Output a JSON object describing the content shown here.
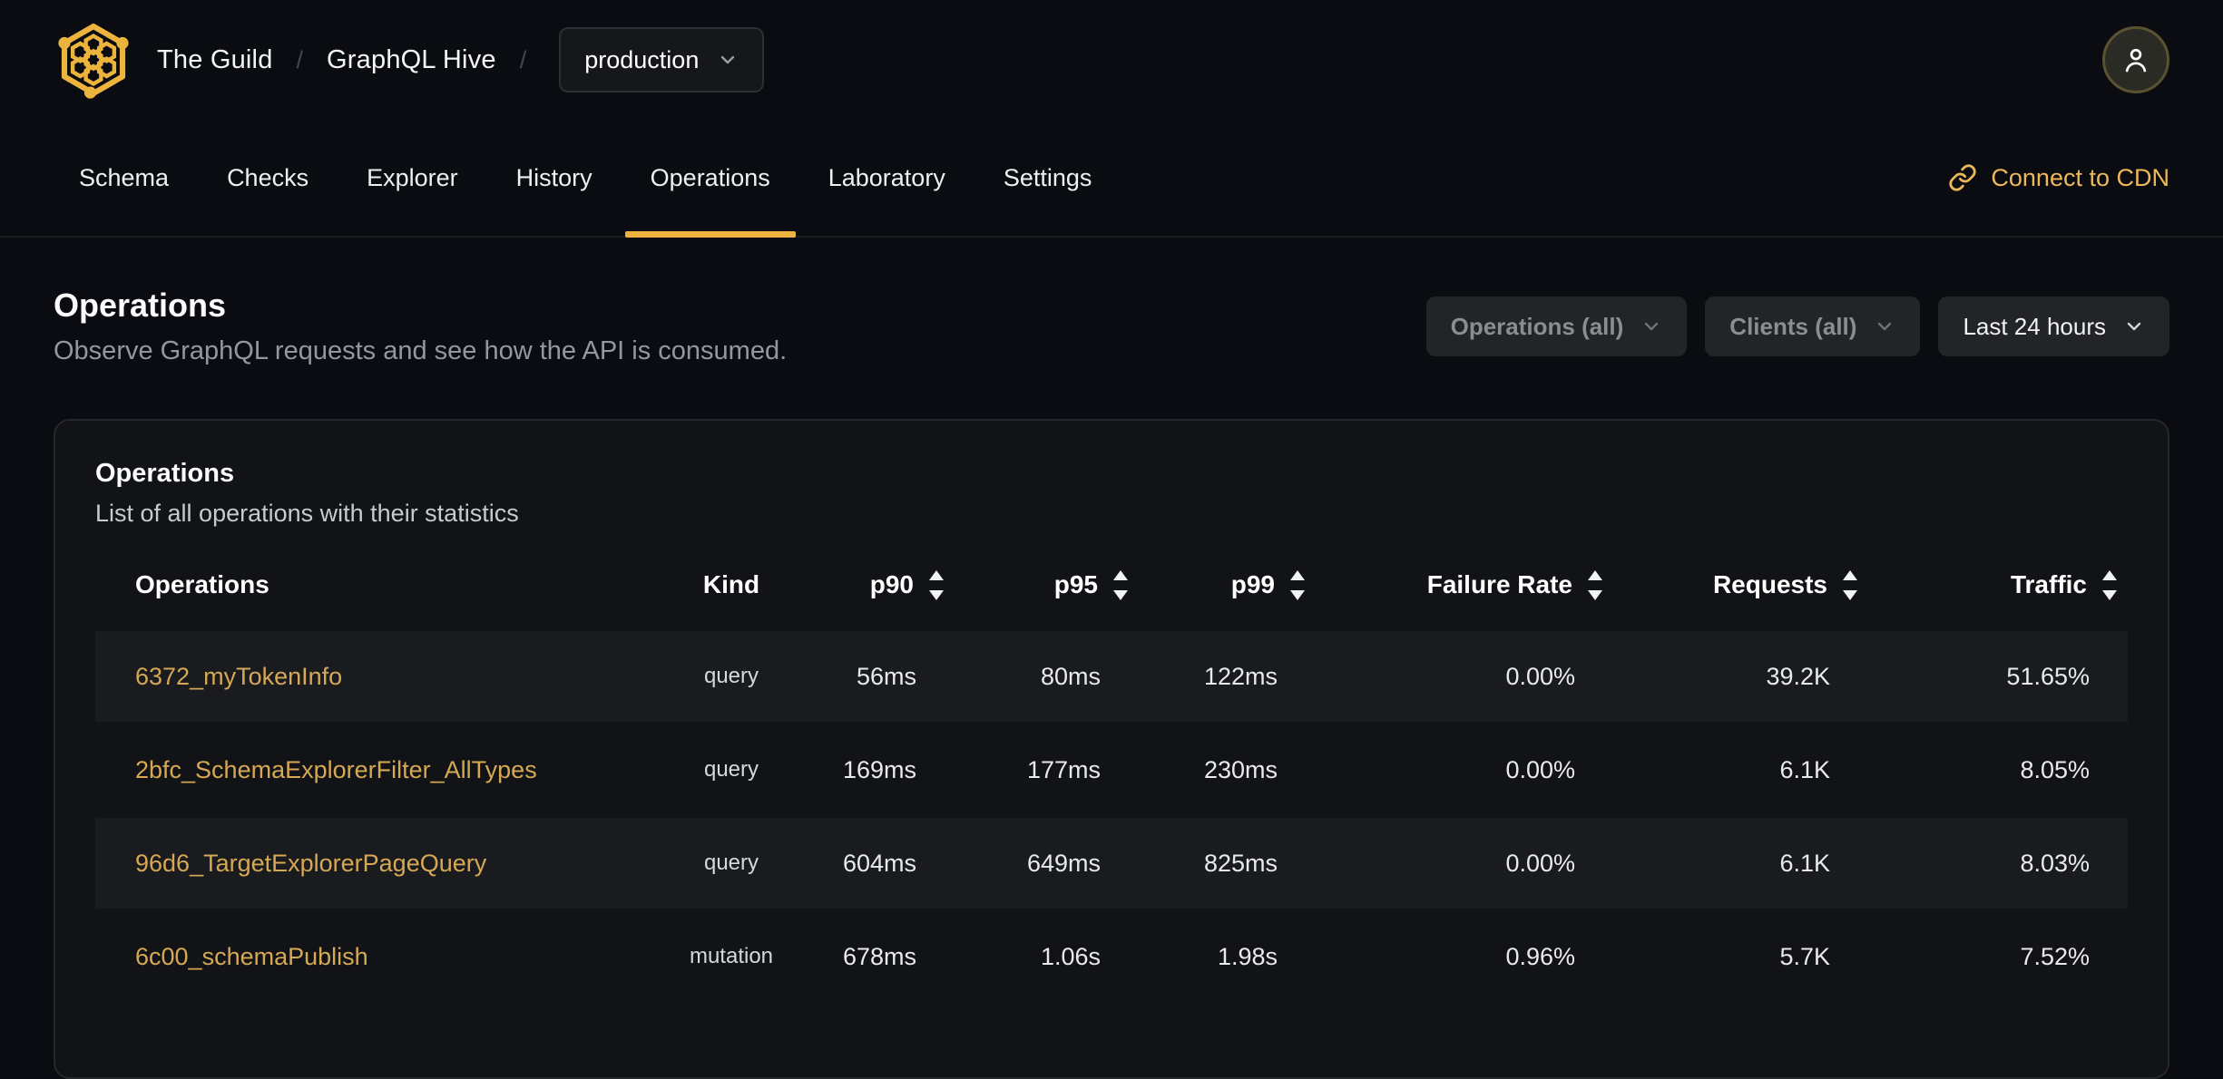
{
  "breadcrumb": {
    "org": "The Guild",
    "separator": "/",
    "project": "GraphQL Hive",
    "target": "production"
  },
  "nav": {
    "tabs": [
      {
        "label": "Schema"
      },
      {
        "label": "Checks"
      },
      {
        "label": "Explorer"
      },
      {
        "label": "History"
      },
      {
        "label": "Operations",
        "active": true
      },
      {
        "label": "Laboratory"
      },
      {
        "label": "Settings"
      }
    ],
    "cdn_link_label": "Connect to CDN"
  },
  "page": {
    "title": "Operations",
    "subtitle": "Observe GraphQL requests and see how the API is consumed."
  },
  "filters": {
    "operations_label": "Operations (all)",
    "clients_label": "Clients (all)",
    "period_label": "Last 24 hours"
  },
  "card": {
    "title": "Operations",
    "subtitle": "List of all operations with their statistics"
  },
  "table": {
    "columns": [
      "Operations",
      "Kind",
      "p90",
      "p95",
      "p99",
      "Failure Rate",
      "Requests",
      "Traffic"
    ],
    "sortable_columns": [
      "p90",
      "p95",
      "p99",
      "Failure Rate",
      "Requests",
      "Traffic"
    ],
    "rows": [
      {
        "operation": "6372_myTokenInfo",
        "kind": "query",
        "p90": "56ms",
        "p95": "80ms",
        "p99": "122ms",
        "failure_rate": "0.00%",
        "requests": "39.2K",
        "traffic": "51.65%"
      },
      {
        "operation": "2bfc_SchemaExplorerFilter_AllTypes",
        "kind": "query",
        "p90": "169ms",
        "p95": "177ms",
        "p99": "230ms",
        "failure_rate": "0.00%",
        "requests": "6.1K",
        "traffic": "8.05%"
      },
      {
        "operation": "96d6_TargetExplorerPageQuery",
        "kind": "query",
        "p90": "604ms",
        "p95": "649ms",
        "p99": "825ms",
        "failure_rate": "0.00%",
        "requests": "6.1K",
        "traffic": "8.03%"
      },
      {
        "operation": "6c00_schemaPublish",
        "kind": "mutation",
        "p90": "678ms",
        "p95": "1.06s",
        "p99": "1.98s",
        "failure_rate": "0.96%",
        "requests": "5.7K",
        "traffic": "7.52%"
      }
    ]
  },
  "icons": {
    "logo": "hive-honeycomb-logo",
    "link": "chain-link-icon",
    "user": "person-icon",
    "chevron": "chevron-down-icon",
    "sort": "sort-arrows-icon"
  },
  "colors": {
    "accent": "#eeb33f",
    "link_text": "#d6a854",
    "page_bg": "#0a0c11",
    "card_bg": "#121317",
    "row_stripe_bg": "#191b1f"
  }
}
